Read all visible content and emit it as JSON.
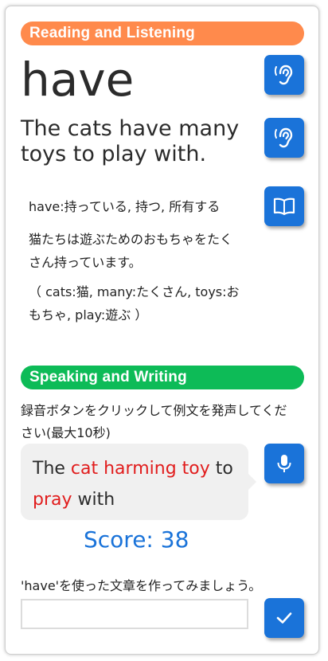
{
  "reading": {
    "header": "Reading and Listening",
    "word": "have",
    "sentence": "The cats have many toys to play with.",
    "definition": "have:持っている, 持つ, 所有する",
    "translation": "猫たちは遊ぶためのおもちゃをたくさん持っています。",
    "glossary": "（ cats:猫, many:たくさん, toys:おもちゃ, play:遊ぶ ）",
    "listen_word_icon": "ear-icon",
    "listen_sentence_icon": "ear-icon",
    "dictionary_icon": "open-book-icon"
  },
  "speaking": {
    "header": "Speaking and Writing",
    "instruction": "録音ボタンをクリックして例文を発声してください(最大10秒)",
    "recognized": [
      {
        "text": "The ",
        "error": false
      },
      {
        "text": "cat harming toy",
        "error": true
      },
      {
        "text": " to ",
        "error": false
      },
      {
        "text": "pray",
        "error": true
      },
      {
        "text": " with",
        "error": false
      }
    ],
    "score": "Score: 38",
    "record_icon": "microphone-icon",
    "prompt": "'have'を使った文章を作ってみましょう。",
    "input_value": "",
    "submit_icon": "checkmark-icon"
  },
  "colors": {
    "reading_header": "#ff8a4c",
    "speaking_header": "#0dbb57",
    "button": "#1a73d9",
    "error_text": "#e11d1d",
    "score_text": "#1a73d9"
  }
}
